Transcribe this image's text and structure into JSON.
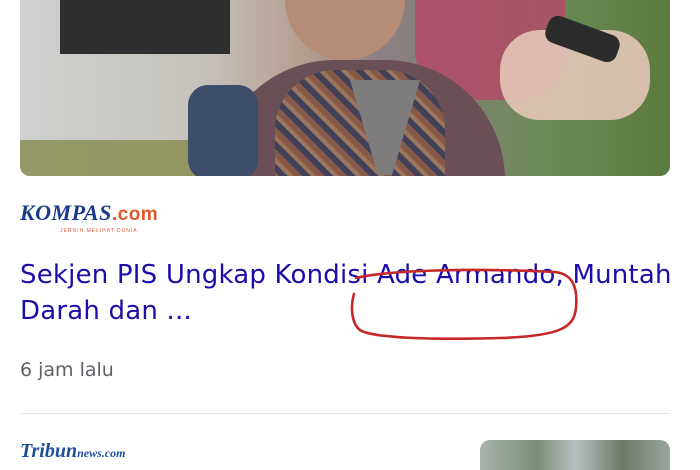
{
  "card": {
    "source": {
      "name": "KOMPAS",
      "suffix": ".com",
      "tagline": "JERNIH MELIHAT DUNIA"
    },
    "headline": "Sekjen PIS Ungkap Kondisi Ade Armando, Muntah Darah dan ...",
    "time": "6 jam lalu",
    "highlight_color": "#c62828"
  },
  "next_card": {
    "source": {
      "name": "Tribun",
      "suffix": "news.com"
    }
  },
  "colors": {
    "link": "#1a0dab",
    "meta": "#5f6368",
    "kompas_blue": "#1b3a8a",
    "kompas_orange": "#e2572b"
  }
}
